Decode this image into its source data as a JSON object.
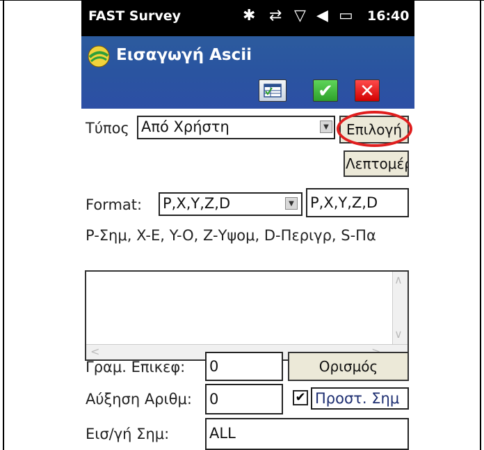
{
  "status": {
    "app_name": "FAST Survey",
    "time": "16:40",
    "icons": [
      "bluetooth-icon",
      "sync-icon",
      "no-signal-icon",
      "volume-icon",
      "battery-icon"
    ]
  },
  "title": {
    "text": "Εισαγωγή Ascii"
  },
  "form": {
    "type_label": "Τύπος",
    "type_value": "Από Χρήστη",
    "select_button": "Επιλογή",
    "details_button": "Λεπτομέρ",
    "format_label": "Format:",
    "format_value": "P,X,Y,Z,D",
    "format_text": "P,X,Y,Z,D",
    "legend": "P-Σημ, X-E, Y-O, Z-Υψομ, D-Περιγρ, S-Πα",
    "header_lines_label": "Γραμ. Επικεφ:",
    "header_lines_value": "0",
    "define_button": "Ορισμός",
    "increment_label": "Αύξηση Αριθμ:",
    "increment_value": "0",
    "add_point_label": "Προστ. Σημ",
    "import_points_label": "Εισ/γή Σημ:",
    "import_points_value": "ALL"
  },
  "colors": {
    "title_bar": "#2a54a0",
    "ok": "#2ea12a",
    "cancel": "#d10000",
    "highlight": "#e01e1e"
  }
}
